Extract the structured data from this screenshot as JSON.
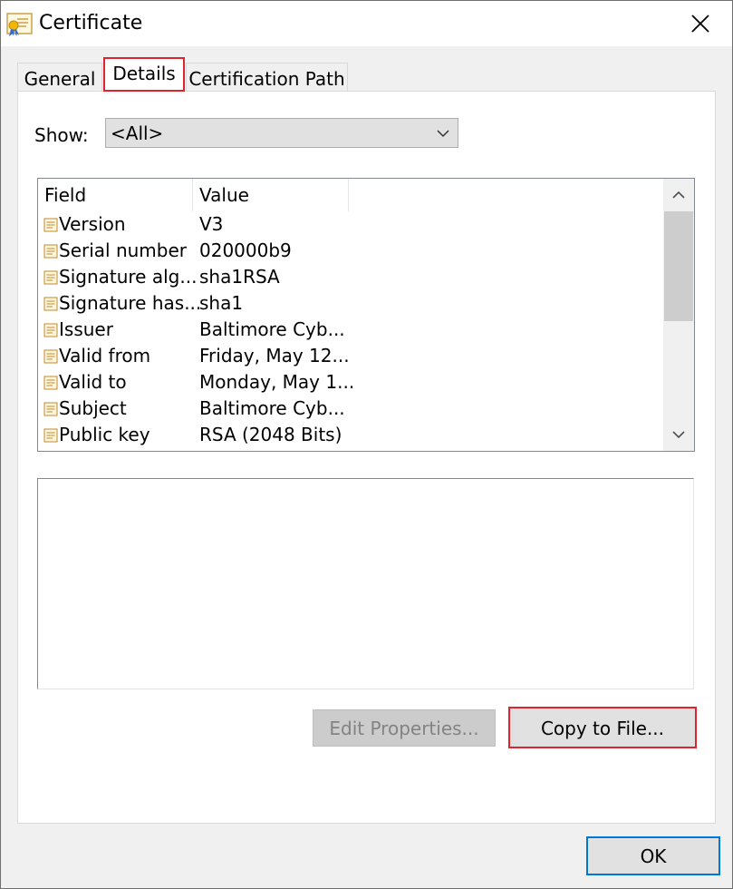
{
  "window": {
    "title": "Certificate"
  },
  "tabs": [
    {
      "label": "General"
    },
    {
      "label": "Details"
    },
    {
      "label": "Certification Path"
    }
  ],
  "show": {
    "label": "Show:",
    "value": "<All>"
  },
  "fields_table": {
    "headers": {
      "field": "Field",
      "value": "Value"
    },
    "rows": [
      {
        "field": "Version",
        "value": "V3"
      },
      {
        "field": "Serial number",
        "value": "020000b9"
      },
      {
        "field": "Signature alg...",
        "value": "sha1RSA"
      },
      {
        "field": "Signature has...",
        "value": "sha1"
      },
      {
        "field": "Issuer",
        "value": "Baltimore Cyb..."
      },
      {
        "field": "Valid from",
        "value": "Friday, May 12..."
      },
      {
        "field": "Valid to",
        "value": "Monday, May 1..."
      },
      {
        "field": "Subject",
        "value": "Baltimore Cyb..."
      },
      {
        "field": "Public key",
        "value": "RSA (2048 Bits)"
      }
    ]
  },
  "buttons": {
    "edit_properties": "Edit Properties...",
    "copy_to_file": "Copy to File...",
    "ok": "OK"
  },
  "colors": {
    "highlight_red": "#e0242f",
    "focus_blue": "#0078d7"
  },
  "icons": {
    "title": "certificate-icon",
    "field": "field-icon",
    "close": "close-icon"
  }
}
